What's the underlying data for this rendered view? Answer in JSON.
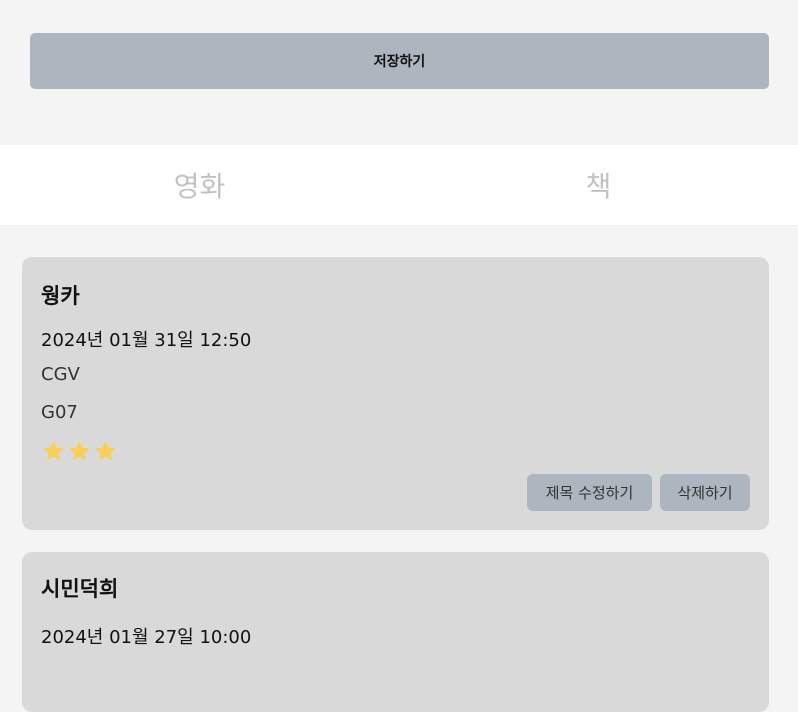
{
  "save_button": {
    "label": "저장하기"
  },
  "tabs": [
    {
      "label": "영화"
    },
    {
      "label": "책"
    }
  ],
  "cards": [
    {
      "title": "웡카",
      "datetime": "2024년 01월 31일 12:50",
      "theater": "CGV",
      "seat": "G07",
      "rating": 3,
      "edit_label": "제목 수정하기",
      "delete_label": "삭제하기"
    },
    {
      "title": "시민덕희",
      "datetime": "2024년 01월 27일 10:00"
    }
  ],
  "colors": {
    "star": "#f7d05a",
    "button": "#adb5bf",
    "card": "#d9d9d9"
  }
}
